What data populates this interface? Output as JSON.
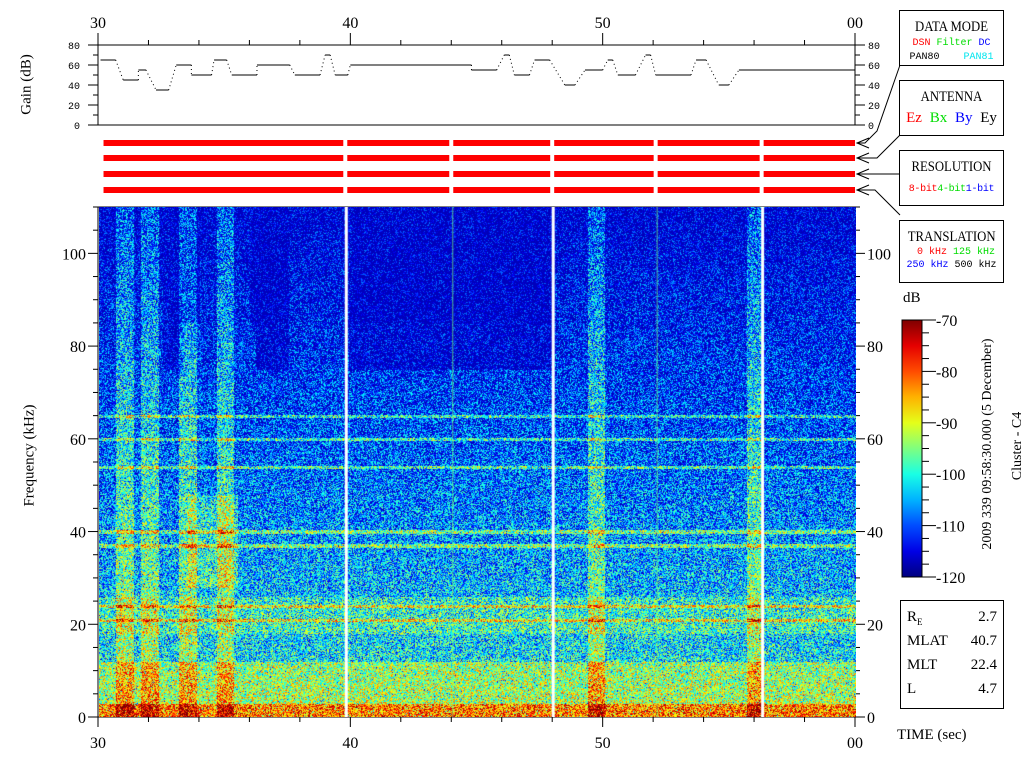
{
  "chart_data": [
    {
      "type": "line",
      "title": "Gain",
      "ylabel": "Gain (dB)",
      "ylim": [
        0,
        80
      ],
      "yticks": [
        "0",
        "20",
        "40",
        "60",
        "80"
      ],
      "xlim": [
        30,
        60
      ],
      "xtick_labels": [
        "30",
        "40",
        "50",
        "00"
      ],
      "segments": [
        [
          30.1,
          30.7,
          65
        ],
        [
          31.0,
          31.6,
          45
        ],
        [
          31.6,
          31.9,
          55
        ],
        [
          32.3,
          32.8,
          35
        ],
        [
          33.1,
          33.7,
          60
        ],
        [
          33.7,
          34.5,
          50
        ],
        [
          34.6,
          35.1,
          65
        ],
        [
          35.3,
          36.3,
          50
        ],
        [
          36.3,
          37.6,
          60
        ],
        [
          37.8,
          38.8,
          50
        ],
        [
          39.0,
          39.2,
          70
        ],
        [
          39.4,
          39.9,
          50
        ],
        [
          40.0,
          44.8,
          60
        ],
        [
          44.8,
          45.8,
          55
        ],
        [
          46.1,
          46.3,
          70
        ],
        [
          46.5,
          47.1,
          50
        ],
        [
          47.3,
          47.9,
          65
        ],
        [
          48.5,
          48.9,
          40
        ],
        [
          49.3,
          50.0,
          55
        ],
        [
          50.2,
          50.4,
          65
        ],
        [
          50.6,
          51.3,
          50
        ],
        [
          51.7,
          51.9,
          70
        ],
        [
          52.1,
          53.5,
          50
        ],
        [
          53.7,
          54.1,
          65
        ],
        [
          54.6,
          55.0,
          40
        ],
        [
          55.4,
          60.0,
          55
        ]
      ]
    },
    {
      "type": "heatmap",
      "title": "Spectrogram",
      "xlabel": "TIME (sec)",
      "ylabel": "Frequency (kHz)",
      "xlim": [
        30,
        60
      ],
      "ylim": [
        0,
        110
      ],
      "xtick_labels": [
        "30",
        "40",
        "50",
        "00"
      ],
      "yticks": [
        "0",
        "20",
        "40",
        "60",
        "80",
        "100"
      ],
      "colorbar": {
        "label": "dB",
        "range": [
          -120,
          -70
        ],
        "ticks": [
          "-70",
          "-80",
          "-90",
          "-100",
          "-110",
          "-120"
        ]
      },
      "data_gaps_sec": [
        39.8,
        48.0,
        56.3
      ],
      "mode_changes_sec": [
        44.0,
        52.1
      ],
      "emission_bands_khz": [
        1.5,
        21,
        24,
        37,
        40,
        54,
        60,
        65
      ],
      "broadband_bursts_sec": [
        31.0,
        32.0,
        33.5,
        35.0,
        49.7,
        56.0
      ]
    }
  ],
  "telemetry_bars": {
    "rows": 4,
    "color": "#ff0000",
    "breaks_sec": [
      39.8,
      44.0,
      48.0,
      52.1,
      56.3
    ]
  },
  "legend": {
    "data_mode": {
      "title": "DATA MODE",
      "items": [
        {
          "text": "DSN",
          "color": "#ff0000"
        },
        {
          "text": "Filter",
          "color": "#00dd00"
        },
        {
          "text": "DC",
          "color": "#0000ff"
        },
        {
          "text": "PAN80",
          "color": "#000000"
        },
        {
          "text": "PAN81",
          "color": "#00e5ee"
        }
      ]
    },
    "antenna": {
      "title": "ANTENNA",
      "items": [
        {
          "text": "Ez",
          "color": "#ff0000"
        },
        {
          "text": "Bx",
          "color": "#00dd00"
        },
        {
          "text": "By",
          "color": "#0000ff"
        },
        {
          "text": "Ey",
          "color": "#000000"
        }
      ]
    },
    "resolution": {
      "title": "RESOLUTION",
      "items": [
        {
          "text": "8-bit",
          "color": "#ff0000"
        },
        {
          "text": "4-bit",
          "color": "#00dd00"
        },
        {
          "text": "1-bit",
          "color": "#0000ff"
        }
      ]
    },
    "translation": {
      "title": "TRANSLATION",
      "items": [
        {
          "text": "0 kHz",
          "color": "#ff0000"
        },
        {
          "text": "125 kHz",
          "color": "#00dd00"
        },
        {
          "text": "250 kHz",
          "color": "#0000ff"
        },
        {
          "text": "500 kHz",
          "color": "#000000"
        }
      ]
    }
  },
  "timestamp": "2009 339 09:58:30.000 (5 December)",
  "spacecraft": "Cluster - C4",
  "orbit": [
    {
      "label": "R",
      "sub": "E",
      "value": "2.7"
    },
    {
      "label": "MLAT",
      "value": "40.7"
    },
    {
      "label": "MLT",
      "value": "22.4"
    },
    {
      "label": "L",
      "value": "4.7"
    }
  ],
  "axis_labels": {
    "time": "TIME (sec)",
    "gain": "Gain (dB)",
    "freq": "Frequency (kHz)",
    "db": "dB"
  }
}
